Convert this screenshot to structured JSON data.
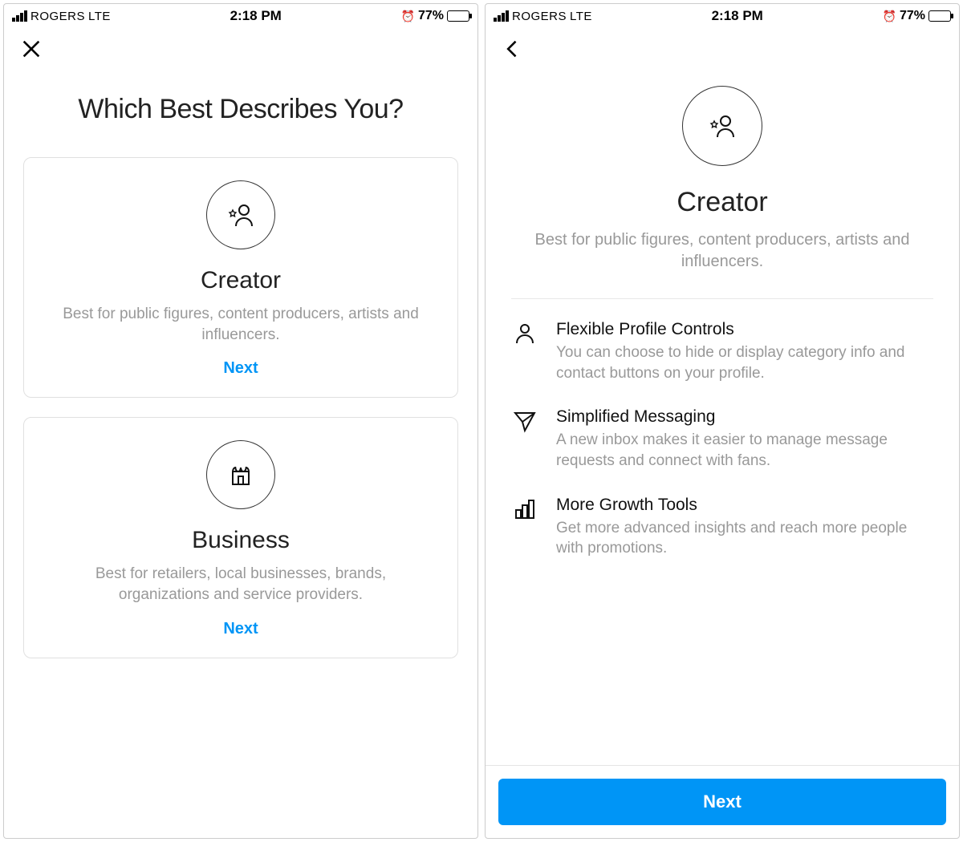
{
  "status": {
    "carrier": "ROGERS",
    "network": "LTE",
    "time": "2:18 PM",
    "battery_percent": "77%",
    "battery_fill_pct": 77
  },
  "screen1": {
    "title": "Which Best Describes You?",
    "cards": [
      {
        "title": "Creator",
        "desc": "Best for public figures, content producers, artists and influencers.",
        "action": "Next"
      },
      {
        "title": "Business",
        "desc": "Best for retailers, local businesses, brands, organizations and service providers.",
        "action": "Next"
      }
    ]
  },
  "screen2": {
    "title": "Creator",
    "desc": "Best for public figures, content producers, artists and influencers.",
    "features": [
      {
        "title": "Flexible Profile Controls",
        "desc": "You can choose to hide or display category info and contact buttons on your profile."
      },
      {
        "title": "Simplified Messaging",
        "desc": "A new inbox makes it easier to manage message requests and connect with fans."
      },
      {
        "title": "More Growth Tools",
        "desc": "Get more advanced insights and reach more people with promotions."
      }
    ],
    "next_button": "Next"
  }
}
